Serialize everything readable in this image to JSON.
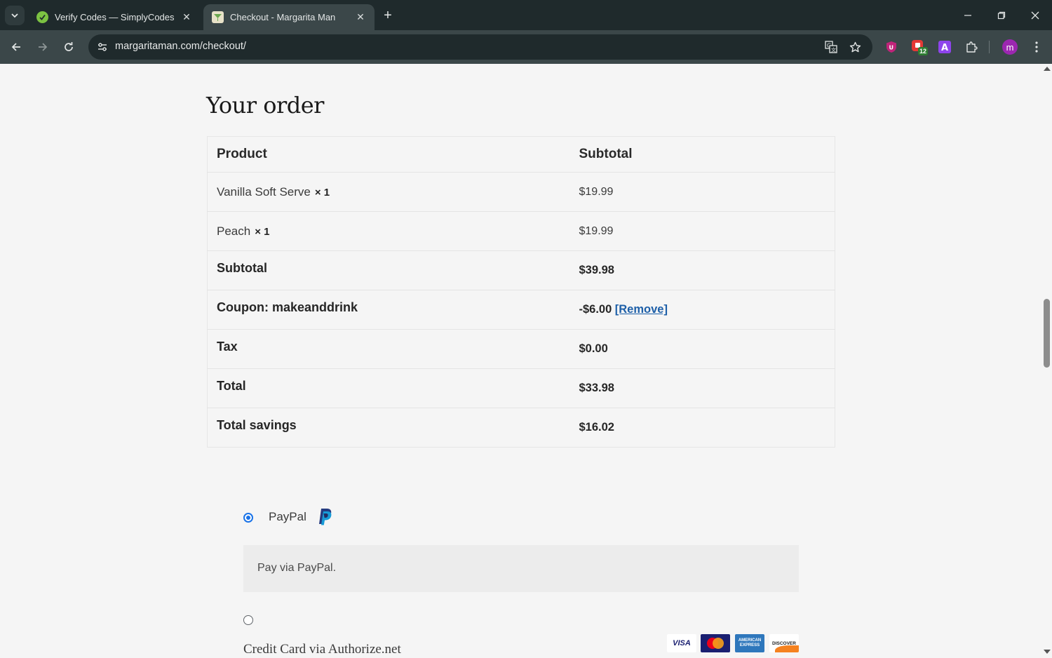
{
  "browser": {
    "tabs": [
      {
        "title": "Verify Codes — SimplyCodes",
        "active": false
      },
      {
        "title": "Checkout - Margarita Man",
        "active": true
      }
    ],
    "url": "margaritaman.com/checkout/",
    "profile_initial": "m",
    "extension_badge": "12"
  },
  "order": {
    "heading": "Your order",
    "columns": {
      "product": "Product",
      "subtotal": "Subtotal"
    },
    "items": [
      {
        "name": "Vanilla Soft Serve",
        "qty": "× 1",
        "price": "$19.99"
      },
      {
        "name": "Peach",
        "qty": "× 1",
        "price": "$19.99"
      }
    ],
    "totals": {
      "subtotal_label": "Subtotal",
      "subtotal_value": "$39.98",
      "coupon_label": "Coupon: makeanddrink",
      "coupon_value": "-$6.00",
      "coupon_remove": "[Remove]",
      "tax_label": "Tax",
      "tax_value": "$0.00",
      "total_label": "Total",
      "total_value": "$33.98",
      "savings_label": "Total savings",
      "savings_value": "$16.02"
    }
  },
  "payment": {
    "paypal_label": "PayPal",
    "paypal_description": "Pay via PayPal.",
    "paypal_selected": true,
    "credit_card_label": "Credit Card via Authorize.net",
    "credit_card_selected": false,
    "card_brands": [
      "VISA",
      "Mastercard",
      "American Express",
      "DISCOVER"
    ]
  },
  "colors": {
    "accent": "#1a73e8",
    "link": "#1d5fa8",
    "chrome_dark": "#1f2a2c",
    "chrome_toolbar": "#3b4749"
  }
}
